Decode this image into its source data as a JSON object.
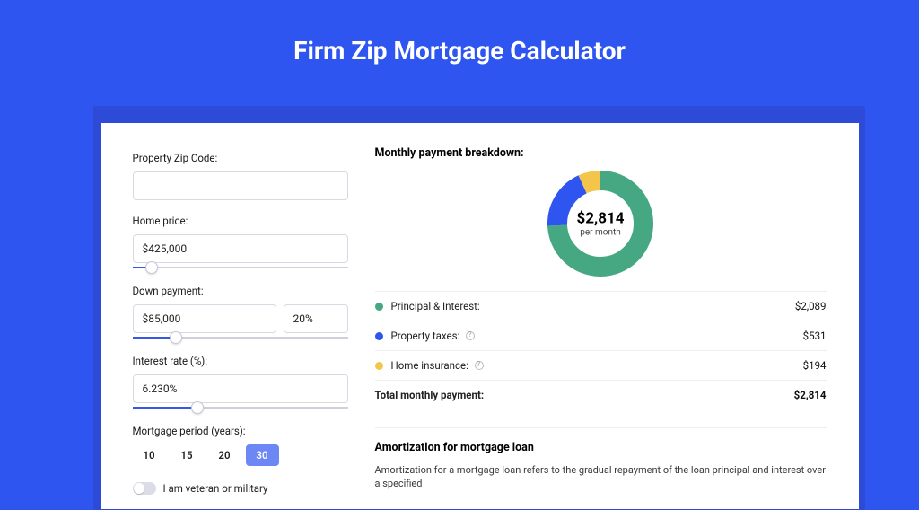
{
  "header": {
    "title": "Firm Zip Mortgage Calculator"
  },
  "form": {
    "zip_label": "Property Zip Code:",
    "zip_value": "",
    "price_label": "Home price:",
    "price_value": "$425,000",
    "down_label": "Down payment:",
    "down_value": "$85,000",
    "down_pct": "20%",
    "rate_label": "Interest rate (%):",
    "rate_value": "6.230%",
    "period_label": "Mortgage period (years):",
    "periods": [
      "10",
      "15",
      "20",
      "30"
    ],
    "period_selected": "30",
    "veteran_label": "I am veteran or military"
  },
  "breakdown": {
    "title": "Monthly payment breakdown:",
    "center_amount": "$2,814",
    "center_sub": "per month",
    "rows": [
      {
        "color": "#45a882",
        "label": "Principal & Interest:",
        "value": "$2,089",
        "info": false
      },
      {
        "color": "#2f55f1",
        "label": "Property taxes:",
        "value": "$531",
        "info": true
      },
      {
        "color": "#f3c64b",
        "label": "Home insurance:",
        "value": "$194",
        "info": true
      }
    ],
    "total_label": "Total monthly payment:",
    "total_value": "$2,814"
  },
  "amort": {
    "title": "Amortization for mortgage loan",
    "text": "Amortization for a mortgage loan refers to the gradual repayment of the loan principal and interest over a specified"
  },
  "chart_data": {
    "type": "pie",
    "title": "Monthly payment breakdown",
    "series": [
      {
        "name": "Principal & Interest",
        "value": 2089,
        "color": "#45a882"
      },
      {
        "name": "Property taxes",
        "value": 531,
        "color": "#2f55f1"
      },
      {
        "name": "Home insurance",
        "value": 194,
        "color": "#f3c64b"
      }
    ],
    "total": 2814,
    "unit": "USD per month"
  }
}
